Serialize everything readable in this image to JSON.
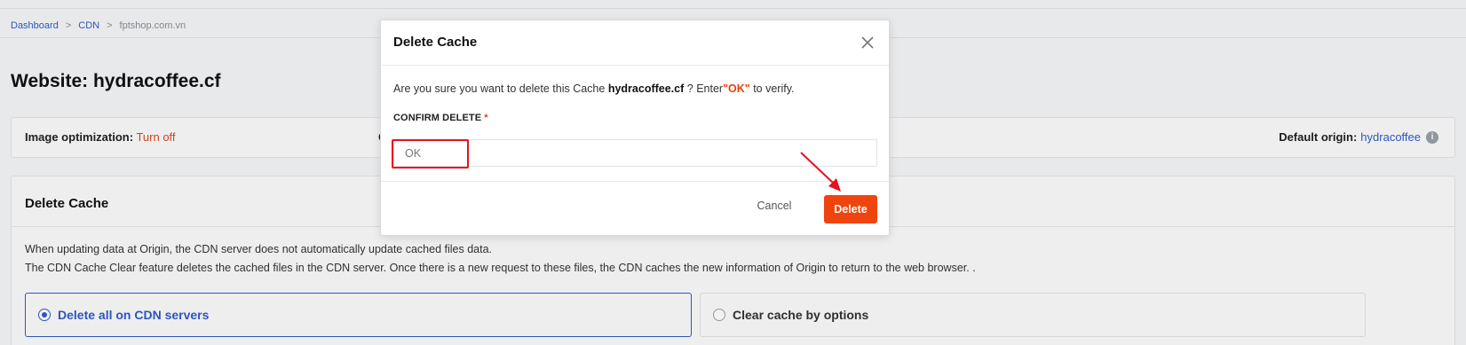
{
  "breadcrumb": {
    "items": [
      "Dashboard",
      "CDN",
      "fptshop.com.vn"
    ],
    "separator": ">"
  },
  "page": {
    "title": "Website: hydracoffee.cf"
  },
  "info": {
    "image_optimization_label": "Image optimization:",
    "image_optimization_value": "Turn off",
    "middle_partial": "C",
    "default_origin_label": "Default origin:",
    "default_origin_value": "hydracoffee",
    "info_icon": "info-icon"
  },
  "delete_cache_section": {
    "title": "Delete Cache",
    "desc1": "When updating data at Origin, the CDN server does not automatically update cached files data.",
    "desc2": "The CDN Cache Clear feature deletes the cached files in the CDN server. Once there is a new request to these files, the CDN caches the new information of Origin to return to the web browser. .",
    "options": [
      {
        "label": "Delete all on CDN servers",
        "selected": true
      },
      {
        "label": "Clear cache by options",
        "selected": false
      }
    ]
  },
  "modal": {
    "title": "Delete Cache",
    "msg_prefix": "Are you sure you want to delete this Cache",
    "msg_name": "hydracoffee.cf",
    "msg_mid": "? Enter",
    "msg_quote_open": "\"",
    "msg_ok": "OK",
    "msg_quote_close": "\"",
    "msg_suffix": "to verify.",
    "field_label": "CONFIRM DELETE",
    "required_mark": "*",
    "input_value": "OK",
    "cancel_label": "Cancel",
    "delete_label": "Delete"
  },
  "colors": {
    "accent": "#2f5bc9",
    "danger": "#f0440e",
    "highlight": "#e4121f"
  }
}
